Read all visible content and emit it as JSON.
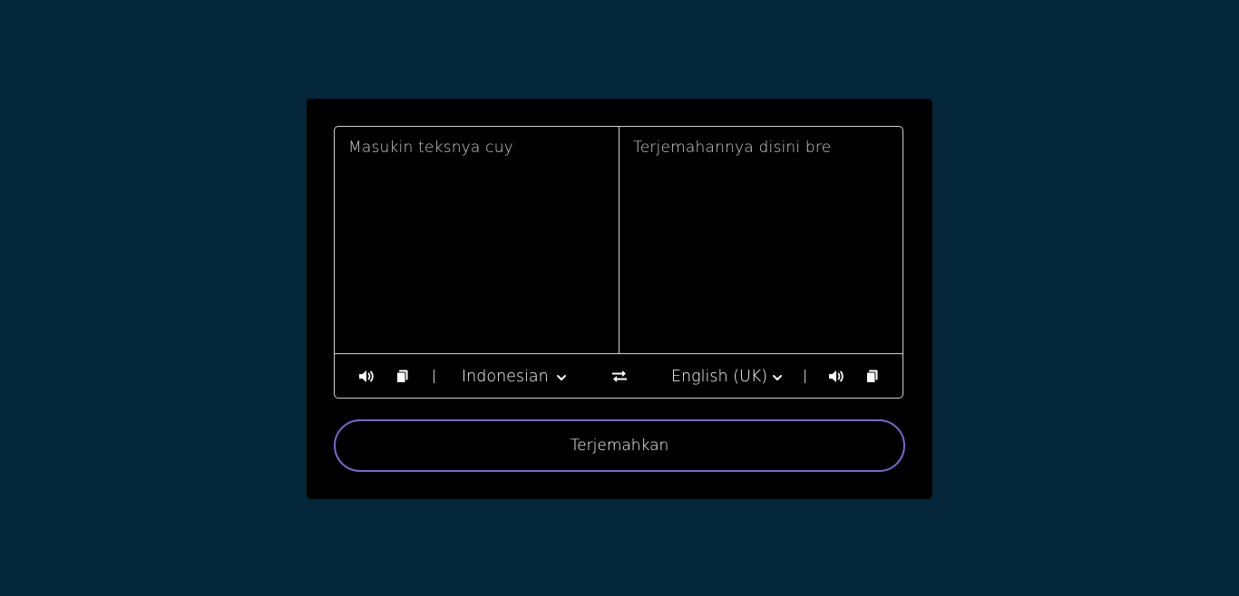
{
  "input": {
    "placeholder": "Masukin teksnya cuy",
    "value": ""
  },
  "output": {
    "placeholder": "Terjemahannya disini bre",
    "value": ""
  },
  "controls": {
    "from_language": "Indonesian",
    "to_language": "English (UK)",
    "icons": {
      "speak": "speaker-icon",
      "copy": "copy-icon",
      "swap": "swap-icon",
      "dropdown": "chevron-down-icon"
    }
  },
  "translate_button": {
    "label": "Terjemahkan"
  },
  "colors": {
    "background": "#04263a",
    "card": "#000000",
    "border": "#cfcfcf",
    "button_border": "#7b68c9"
  }
}
